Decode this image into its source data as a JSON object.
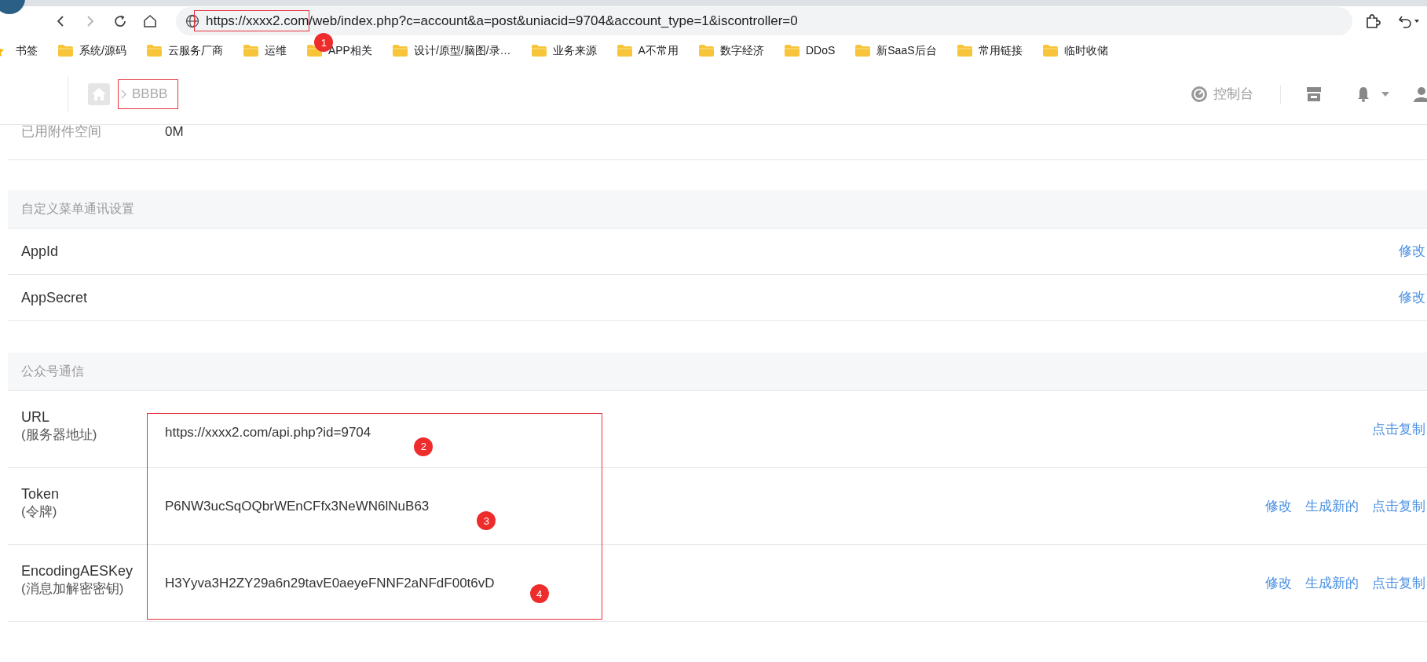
{
  "browser": {
    "nav": [
      {
        "kind": "back",
        "disabled": false
      },
      {
        "kind": "forward",
        "disabled": true
      },
      {
        "kind": "reload",
        "disabled": false
      },
      {
        "kind": "home",
        "disabled": false
      }
    ],
    "url_segments": [
      "https://xxxx2.com",
      "/web/index.php?c=account&a=post&uniacid=9704&account_type=1&iscontroller=0"
    ]
  },
  "bookmarks": [
    {
      "kind": "star",
      "label": "书签"
    },
    {
      "kind": "folder",
      "label": "系统/源码"
    },
    {
      "kind": "folder",
      "label": "云服务厂商"
    },
    {
      "kind": "folder",
      "label": "运维"
    },
    {
      "kind": "folder",
      "label": "APP相关"
    },
    {
      "kind": "folder",
      "label": "设计/原型/脑图/录…"
    },
    {
      "kind": "folder",
      "label": "业务来源"
    },
    {
      "kind": "folder",
      "label": "A不常用"
    },
    {
      "kind": "folder",
      "label": "数字经济"
    },
    {
      "kind": "folder",
      "label": "DDoS"
    },
    {
      "kind": "folder",
      "label": "新SaaS后台"
    },
    {
      "kind": "folder",
      "label": "常用链接"
    },
    {
      "kind": "folder",
      "label": "临时收储"
    }
  ],
  "header": {
    "breadcrumb": "BBBB",
    "console": "控制台"
  },
  "partial_row": {
    "label": "已用附件空间",
    "value": "0M"
  },
  "sections": [
    {
      "title": "自定义菜单通讯设置",
      "rows": [
        {
          "label": "AppId",
          "actions": [
            "修改"
          ]
        },
        {
          "label": "AppSecret",
          "actions": [
            "修改"
          ]
        }
      ]
    },
    {
      "title": "公众号通信",
      "rows": [
        {
          "label": "URL",
          "sublabel": "(服务器地址)",
          "value": "https://xxxx2.com/api.php?id=9704",
          "actions": [
            "点击复制"
          ]
        },
        {
          "label": "Token",
          "sublabel": "(令牌)",
          "value": "P6NW3ucSqOQbrWEnCFfx3NeWN6lNuB63",
          "actions": [
            "修改",
            "生成新的",
            "点击复制"
          ]
        },
        {
          "label": "EncodingAESKey",
          "sublabel": "(消息加解密密钥)",
          "value": "H3Yyva3H2ZY29a6n29tavE0aeyeFNNF2aNFdF00t6vD",
          "actions": [
            "修改",
            "生成新的",
            "点击复制"
          ]
        }
      ]
    }
  ],
  "annotations": {
    "boxes": [
      {
        "kind": "host"
      },
      {
        "kind": "crumb"
      },
      {
        "kind": "values"
      }
    ],
    "markers": [
      {
        "number": "1",
        "kind": "host"
      },
      {
        "number": "2",
        "kind": "value"
      },
      {
        "number": "3",
        "kind": "value"
      },
      {
        "number": "4",
        "kind": "value"
      }
    ]
  }
}
